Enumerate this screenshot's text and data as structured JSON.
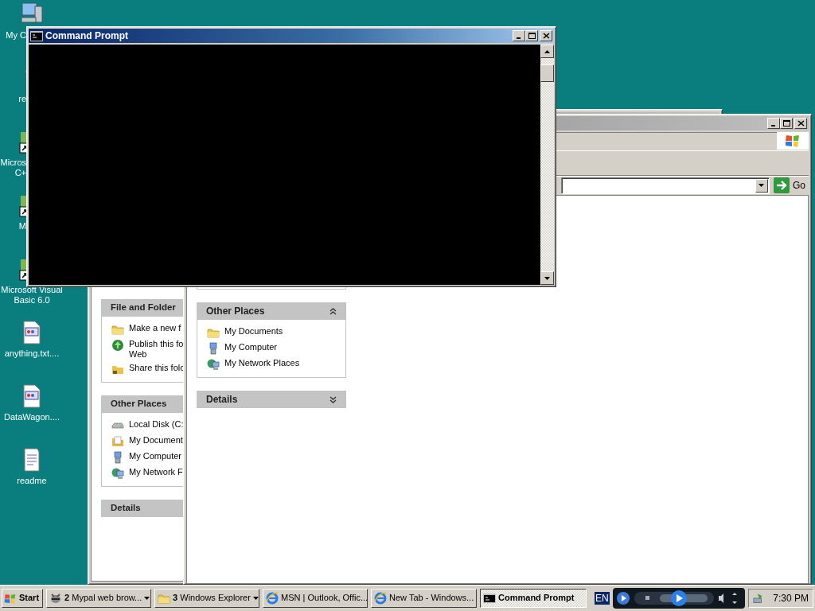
{
  "desktop": {
    "icons": [
      {
        "label": "My C",
        "kind": "computer"
      },
      {
        "label": "re",
        "kind": "recycle"
      },
      {
        "label": "Micros C+",
        "kind": "shortcut"
      },
      {
        "label": "M",
        "kind": "shortcut"
      },
      {
        "label": "Microsoft Visual Basic 6.0",
        "kind": "shortcut"
      },
      {
        "label": "anything.txt....",
        "kind": "document"
      },
      {
        "label": "DataWagon....",
        "kind": "document"
      },
      {
        "label": "readme",
        "kind": "text"
      }
    ]
  },
  "back_explorer": {
    "task_panes": [
      {
        "title": "File and Folder",
        "items": [
          {
            "label": "Make a new f",
            "kind": "folder"
          },
          {
            "label": "Publish this fo\nWeb",
            "kind": "globe"
          },
          {
            "label": "Share this folc",
            "kind": "share"
          }
        ]
      },
      {
        "title": "Other Places",
        "items": [
          {
            "label": "Local Disk (C:",
            "kind": "disk"
          },
          {
            "label": "My Document",
            "kind": "documents"
          },
          {
            "label": "My Computer",
            "kind": "computer"
          },
          {
            "label": "My Network F",
            "kind": "network"
          }
        ]
      },
      {
        "title": "Details"
      }
    ]
  },
  "front_explorer": {
    "active": false,
    "go_label": "Go",
    "task_panes": [
      {
        "title": "Other Places",
        "expanded": true,
        "items": [
          {
            "label": "My Documents",
            "kind": "folder"
          },
          {
            "label": "My Computer",
            "kind": "computer"
          },
          {
            "label": "My Network Places",
            "kind": "network"
          }
        ]
      },
      {
        "title": "Details",
        "expanded": false
      }
    ]
  },
  "console": {
    "title": "Command Prompt",
    "active": true
  },
  "taskbar": {
    "start_label": "Start",
    "buttons": [
      {
        "count": "2",
        "label": "Mypal web brow...",
        "kind": "mypal",
        "selected": false
      },
      {
        "count": "3",
        "label": "Windows Explorer",
        "kind": "folder",
        "selected": false
      },
      {
        "label": "MSN | Outlook, Offic...",
        "kind": "ie",
        "selected": false
      },
      {
        "label": "New Tab - Windows...",
        "kind": "ie",
        "selected": false
      },
      {
        "label": "Command Prompt",
        "kind": "cmd",
        "selected": true
      }
    ],
    "language": "EN",
    "clock": "7:30 PM"
  }
}
